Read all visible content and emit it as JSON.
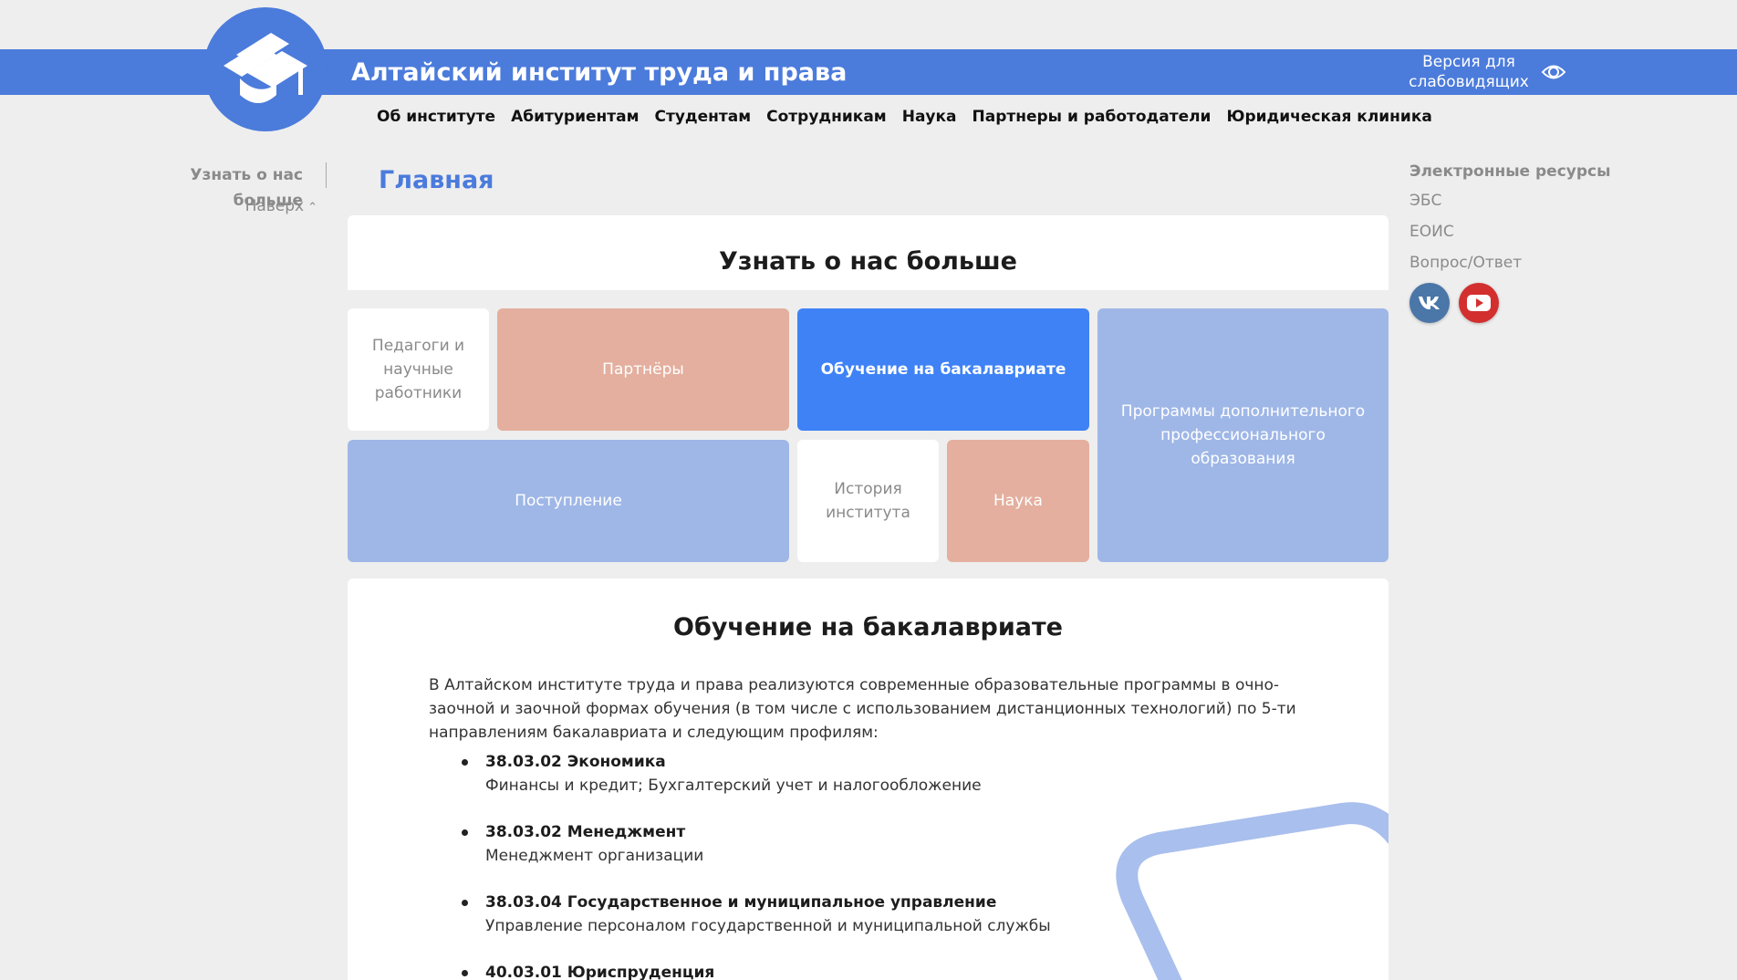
{
  "header": {
    "title": "Алтайский институт труда и права",
    "accessibility_label": "Версия для слабовидящих",
    "accent_color": "#4b7bdb"
  },
  "nav": {
    "items": [
      {
        "label": "Об институте"
      },
      {
        "label": "Абитуриентам"
      },
      {
        "label": "Студентам"
      },
      {
        "label": "Сотрудникам"
      },
      {
        "label": "Наука"
      },
      {
        "label": "Партнеры и работодатели"
      },
      {
        "label": "Юридическая клиника"
      }
    ]
  },
  "left_sidebar": {
    "link": "Узнать о нас больше",
    "up_label": "Наверх"
  },
  "right_sidebar": {
    "heading": "Электронные ресурсы",
    "links": [
      {
        "label": "ЭБС"
      },
      {
        "label": "ЕОИС"
      },
      {
        "label": "Вопрос/Ответ"
      }
    ],
    "socials": [
      {
        "icon": "vk-icon",
        "color": "#4a76a8"
      },
      {
        "icon": "youtube-icon",
        "color": "#d32f2f"
      }
    ]
  },
  "main": {
    "page_heading": "Главная",
    "about_heading": "Узнать о нас больше",
    "tiles": {
      "teachers": "Педагоги и научные работники",
      "partners": "Партнёры",
      "bachelor": "Обучение на бакалавриате",
      "additional": "Программы дополнительного профессионального образования",
      "admission": "Поступление",
      "history": "История института",
      "science": "Наука"
    },
    "section": {
      "title": "Обучение на бакалавриате",
      "intro": "В Алтайском институте труда и права реализуются современные образовательные программы в очно-заочной и заочной формах обучения (в том числе с использованием дистанционных технологий) по 5-ти направлениям бакалавриата и следующим профилям:",
      "programs": [
        {
          "code": "38.03.02 Экономика",
          "profile": "Финансы и кредит; Бухгалтерский учет и налогообложение"
        },
        {
          "code": "38.03.02 Менеджмент",
          "profile": "Менеджмент организации"
        },
        {
          "code": "38.03.04 Государственное и муниципальное управление",
          "profile": "Управление персоналом государственной и муниципальной службы"
        },
        {
          "code": "40.03.01 Юриспруденция",
          "profile": ""
        }
      ]
    }
  }
}
